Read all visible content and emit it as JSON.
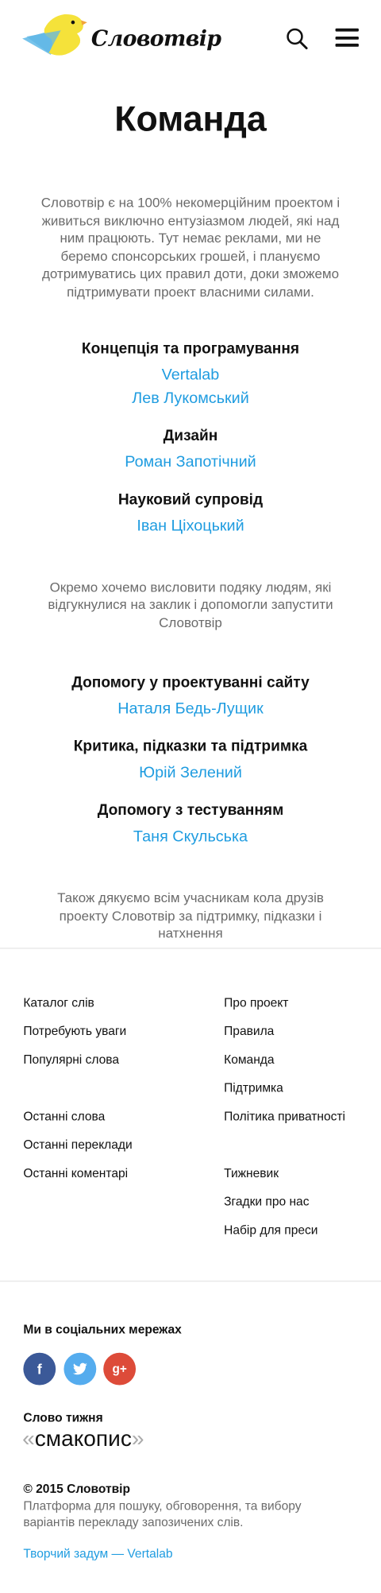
{
  "header": {
    "logo_text": "Словотвір",
    "logo_icon": "bird-logo",
    "search_icon": "search-icon",
    "menu_icon": "hamburger-menu-icon"
  },
  "main": {
    "title": "Команда",
    "intro": "Словотвір є на 100% некомерційним проектом і живиться виключно ентузіазмом людей, які над ним працюють. Тут немає реклами, ми не беремо спонсорських грошей, і плануємо дотримуватись цих правил доти, доки зможемо підтримувати проект власними силами.",
    "team": [
      {
        "role": "Концепція та програмування",
        "people": [
          "Vertalab",
          "Лев Лукомський"
        ]
      },
      {
        "role": "Дизайн",
        "people": [
          "Роман Запотічний"
        ]
      },
      {
        "role": "Науковий супровід",
        "people": [
          "Іван Ціхоцький"
        ]
      }
    ],
    "thanks_intro": "Окремо хочемо висловити подяку людям, які відгукнулися на заклик і допомогли запустити Словотвір",
    "helpers": [
      {
        "role": "Допомогу у проектуванні сайту",
        "people": [
          "Наталя Бедь-Лущик"
        ]
      },
      {
        "role": "Критика, підказки та підтримка",
        "people": [
          "Юрій Зелений"
        ]
      },
      {
        "role": "Допомогу з тестуванням",
        "people": [
          "Таня Скульська"
        ]
      }
    ],
    "thanks_outro": "Також дякуємо всім учасникам кола друзів проекту Словотвір за підтримку, підказки і натхнення"
  },
  "footer": {
    "nav_left": [
      "Каталог слів",
      "Потребують уваги",
      "Популярні слова",
      "",
      "Останні слова",
      "Останні переклади",
      "Останні коментарі"
    ],
    "nav_right": [
      "Про проект",
      "Правила",
      "Команда",
      "Підтримка",
      "Політика приватності",
      "",
      "Тижневик",
      "Згадки про нас",
      "Набір для преси"
    ],
    "social_title": "Ми в соціальних мережах",
    "social": [
      {
        "name": "facebook",
        "glyph": "f",
        "color": "#3b5998"
      },
      {
        "name": "twitter",
        "glyph": "t",
        "color": "#55acee"
      },
      {
        "name": "google-plus",
        "glyph": "g+",
        "color": "#dd4b39"
      }
    ],
    "word_of_week_title": "Слово тижня",
    "word_of_week": "смакопис",
    "quote_open": "«",
    "quote_close": "»",
    "copyright": "© 2015 Словотвір",
    "tagline": "Платформа для пошуку, обговорення, та вибору варіантів перекладу запозичених слів.",
    "credit": "Творчий задум — Vertalab"
  },
  "colors": {
    "accent": "#1f9ce0",
    "text_muted": "#6b6b6b",
    "logo_yellow": "#f5e23a",
    "logo_blue": "#6fc0ea"
  }
}
